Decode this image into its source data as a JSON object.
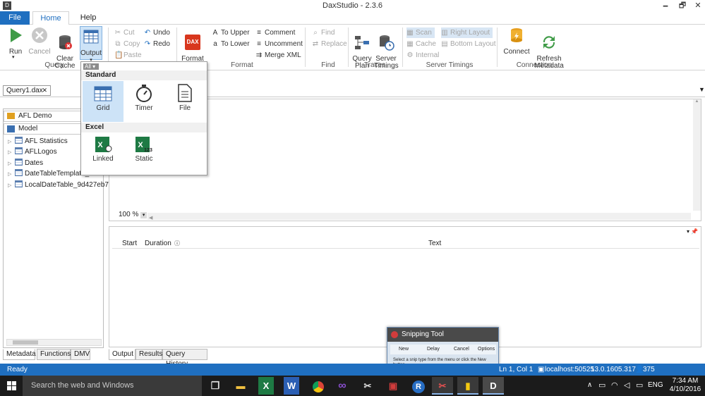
{
  "window": {
    "title": "DaxStudio - 2.3.6",
    "minimize": "🗕",
    "restore": "🗗",
    "close": "✕"
  },
  "ribbon_tabs": [
    "File",
    "Home",
    "Help"
  ],
  "ribbon": {
    "run": "Run",
    "cancel": "Cancel",
    "clear_cache": "Clear\nCache",
    "output": "Output",
    "query_group": "Query",
    "cut": "Cut",
    "copy": "Copy",
    "paste": "Paste",
    "undo": "Undo",
    "redo": "Redo",
    "format_query": "Format\nQuery",
    "to_upper": "To Upper",
    "to_lower": "To Lower",
    "comment": "Comment",
    "uncomment": "Uncomment",
    "merge_xml": "Merge XML",
    "format_group": "Format",
    "find": "Find",
    "replace": "Replace",
    "find_group": "Find",
    "query_plan": "Query\nPlan",
    "server_timings": "Server\nTimings",
    "traces_group": "Traces",
    "scan": "Scan",
    "cache": "Cache",
    "internal": "Internal",
    "right_layout": "Right Layout",
    "bottom_layout": "Bottom Layout",
    "server_timings_group": "Server Timings",
    "connect": "Connect",
    "refresh_metadata": "Refresh\nMetadata",
    "connection_group": "Connection"
  },
  "doc_tab": {
    "label": "Query1.dax",
    "close": "✕"
  },
  "left_panel": {
    "database": "AFL Demo",
    "model": "Model",
    "tables": [
      "AFL Statistics",
      "AFLLogos",
      "Dates",
      "DateTableTemplate_",
      "LocalDateTable_9d427eb7-"
    ],
    "tabs": [
      "Metadata",
      "Functions",
      "DMV"
    ]
  },
  "editor": {
    "zoom": "100 %"
  },
  "output_menu": {
    "filter": "All ▾",
    "sections": [
      {
        "title": "Standard",
        "items": [
          "Grid",
          "Timer",
          "File"
        ]
      },
      {
        "title": "Excel",
        "items": [
          "Linked",
          "Static"
        ]
      }
    ]
  },
  "output_grid": {
    "columns": [
      "Start",
      "Duration",
      "Text"
    ]
  },
  "bottom_tabs": [
    "Output",
    "Results",
    "Query History"
  ],
  "status": {
    "ready": "Ready",
    "position": "Ln 1, Col 1",
    "server": "localhost:50525",
    "version": "13.0.1605.317",
    "spid": "375"
  },
  "snipping_tool": {
    "title": "Snipping Tool",
    "new": "New",
    "delay": "Delay",
    "cancel": "Cancel",
    "options": "Options",
    "hint": "Select a snip type from the menu or click the New button."
  },
  "taskbar": {
    "search": "Search the web and Windows",
    "lang": "ENG",
    "time": "7:34 AM",
    "date": "4/10/2016"
  },
  "colors": {
    "accent": "#1f6fc0",
    "taskbar": "#1b1b1b"
  }
}
